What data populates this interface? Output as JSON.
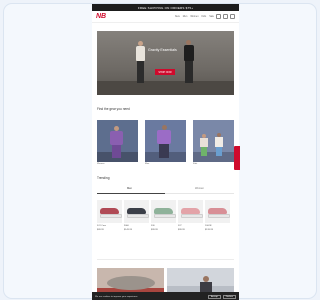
{
  "promo_bar": {
    "text": "FREE SHIPPING ON ORDERS $75+"
  },
  "nav": {
    "logo_label": "NB",
    "links": [
      "New",
      "Men",
      "Women",
      "Kids",
      "Sale"
    ]
  },
  "hero": {
    "title": "Gravity Essentials",
    "cta": "SHOP NOW"
  },
  "categories": {
    "title": "Find the gear you need",
    "items": [
      {
        "label": "Women"
      },
      {
        "label": "Men"
      },
      {
        "label": "Kids"
      }
    ]
  },
  "trending": {
    "title": "Trending",
    "tabs": [
      "Men",
      "Women"
    ],
    "products": [
      {
        "name": "574 Core",
        "price": "$89.99"
      },
      {
        "name": "9060",
        "price": "$149.99"
      },
      {
        "name": "530",
        "price": "$99.99"
      },
      {
        "name": "327",
        "price": "$99.99"
      },
      {
        "name": "2002R",
        "price": "$139.99"
      }
    ]
  },
  "cookie_banner": {
    "text": "We use cookies to improve your experience.",
    "accept": "Accept",
    "decline": "Decline"
  },
  "colors": {
    "brand_red": "#cf0a2c"
  }
}
